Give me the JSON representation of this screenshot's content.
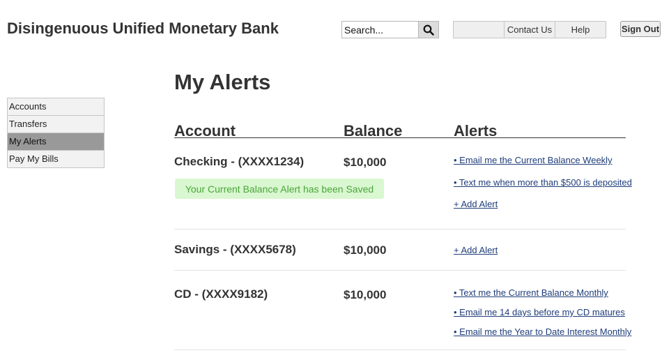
{
  "header": {
    "bank_name": "Disingenuous Unified Monetary Bank",
    "search_placeholder": "Search...",
    "nav": [
      "",
      "Contact Us",
      "Help"
    ],
    "sign_out": "Sign Out"
  },
  "sidebar": {
    "items": [
      {
        "label": "Accounts",
        "active": false
      },
      {
        "label": "Transfers",
        "active": false
      },
      {
        "label": "My Alerts",
        "active": true
      },
      {
        "label": "Pay My Bills",
        "active": false
      }
    ]
  },
  "main": {
    "title": "My Alerts",
    "columns": {
      "account": "Account",
      "balance": "Balance",
      "alerts": "Alerts"
    },
    "accounts": [
      {
        "name": "Checking - (XXXX1234)",
        "balance": "$10,000",
        "alerts": [
          "• Email me the Current Balance Weekly",
          "• Text me when more than $500 is deposited"
        ],
        "add_alert": "+ Add Alert",
        "message": "Your Current Balance Alert has been Saved"
      },
      {
        "name": "Savings - (XXXX5678)",
        "balance": "$10,000",
        "alerts": [],
        "add_alert": "+ Add Alert"
      },
      {
        "name": "CD - (XXXX9182)",
        "balance": "$10,000",
        "alerts": [
          "• Text me the Current Balance Monthly",
          "• Email  me 14 days before my CD matures",
          "• Email me the Year to Date Interest Monthly"
        ]
      }
    ]
  },
  "colors": {
    "text": "#333333",
    "link": "#1f3d7a",
    "success_bg": "#d9f7d0",
    "success_text": "#4aa53a",
    "active_nav": "#999999"
  }
}
